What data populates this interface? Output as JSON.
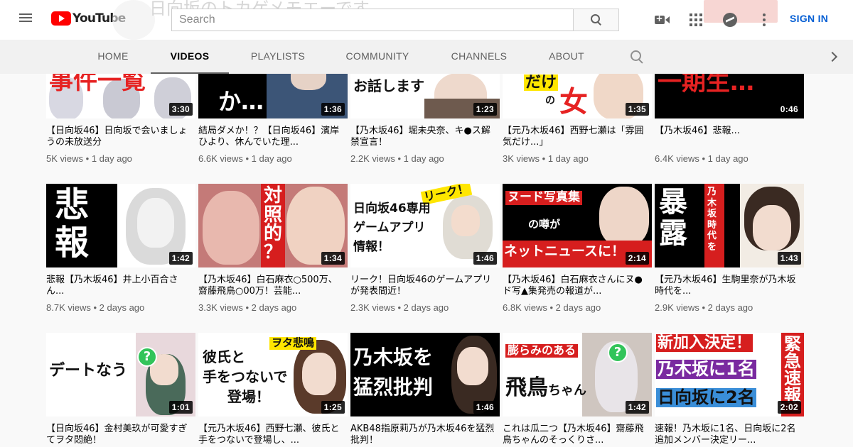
{
  "masthead": {
    "logo_text": "YouTube",
    "search_placeholder": "Search",
    "sign_in": "SIGN IN",
    "channel_name_faded": "日向坂のトカゲメモエーです"
  },
  "tabs": [
    "HOME",
    "VIDEOS",
    "PLAYLISTS",
    "COMMUNITY",
    "CHANNELS",
    "ABOUT"
  ],
  "active_tab": "VIDEOS",
  "videos": [
    {
      "duration": "3:30",
      "title": "【日向坂46】日向坂で会いましょうの未放送分",
      "views": "5K views",
      "age": "1 day ago",
      "thumb_text": "事件一覧"
    },
    {
      "duration": "1:36",
      "title": "結局ダメか！？【日向坂46】濱岸ひより、休んでいた理...",
      "views": "6.6K views",
      "age": "1 day ago",
      "thumb_text": "か…"
    },
    {
      "duration": "1:23",
      "title": "【乃木坂46】堀未央奈、キ●ス解禁宣言！",
      "views": "2.2K views",
      "age": "1 day ago",
      "thumb_text": "お話します"
    },
    {
      "duration": "1:35",
      "title": "【元乃木坂46】西野七瀬は「雰囲気だけ...」",
      "views": "3K views",
      "age": "1 day ago",
      "thumb_text": "の女"
    },
    {
      "duration": "0:46",
      "title": "【乃木坂46】悲報...",
      "views": "6.4K views",
      "age": "1 day ago",
      "thumb_text": "一期生…"
    },
    {
      "duration": "1:42",
      "title": "悲報【乃木坂46】井上小百合さん...",
      "views": "8.7K views",
      "age": "2 days ago",
      "thumb_text": "悲報"
    },
    {
      "duration": "1:34",
      "title": "【乃木坂46】白石麻衣○500万、齋藤飛鳥○00万！芸能...",
      "views": "3.3K views",
      "age": "2 days ago",
      "thumb_text": "対照的？"
    },
    {
      "duration": "1:46",
      "title": "リーク！日向坂46のゲームアプリが発表間近！",
      "views": "2.3K views",
      "age": "2 days ago",
      "thumb_text": "日向坂46専用ゲームアプリ情報！"
    },
    {
      "duration": "2:14",
      "title": "【乃木坂46】白石麻衣さんにヌ●ド写▲集発売の報道が...",
      "views": "6.8K views",
      "age": "2 days ago",
      "thumb_text": "ヌード写真集の噂がネットニュースに！"
    },
    {
      "duration": "1:43",
      "title": "【元乃木坂46】生駒里奈が乃木坂時代を...",
      "views": "2.9K views",
      "age": "2 days ago",
      "thumb_text": "暴露"
    },
    {
      "duration": "1:01",
      "title": "【日向坂46】金村美玖が可愛すぎてヲタ悶絶！",
      "views": "",
      "age": "",
      "thumb_text": "デートなう"
    },
    {
      "duration": "1:25",
      "title": "【元乃木坂46】西野七瀬、彼氏と手をつないで登場し、...",
      "views": "",
      "age": "",
      "thumb_text": "彼氏と手をつないで登場！"
    },
    {
      "duration": "1:46",
      "title": "AKB48指原莉乃が乃木坂46を猛烈批判！",
      "views": "",
      "age": "",
      "thumb_text": "乃木坂を猛烈批判"
    },
    {
      "duration": "1:42",
      "title": "これは瓜二つ【乃木坂46】齋藤飛鳥ちゃんのそっくりさ...",
      "views": "",
      "age": "",
      "thumb_text": "膨らみのある飛鳥ちゃん"
    },
    {
      "duration": "2:02",
      "title": "速報！乃木坂に1名、日向坂に2名追加メンバー決定リー...",
      "views": "",
      "age": "",
      "thumb_text": "新加入決定！乃木坂に1名日向坂に2名"
    }
  ],
  "colors": {
    "accent": "#065fd4",
    "brand_red": "#ff0000"
  }
}
